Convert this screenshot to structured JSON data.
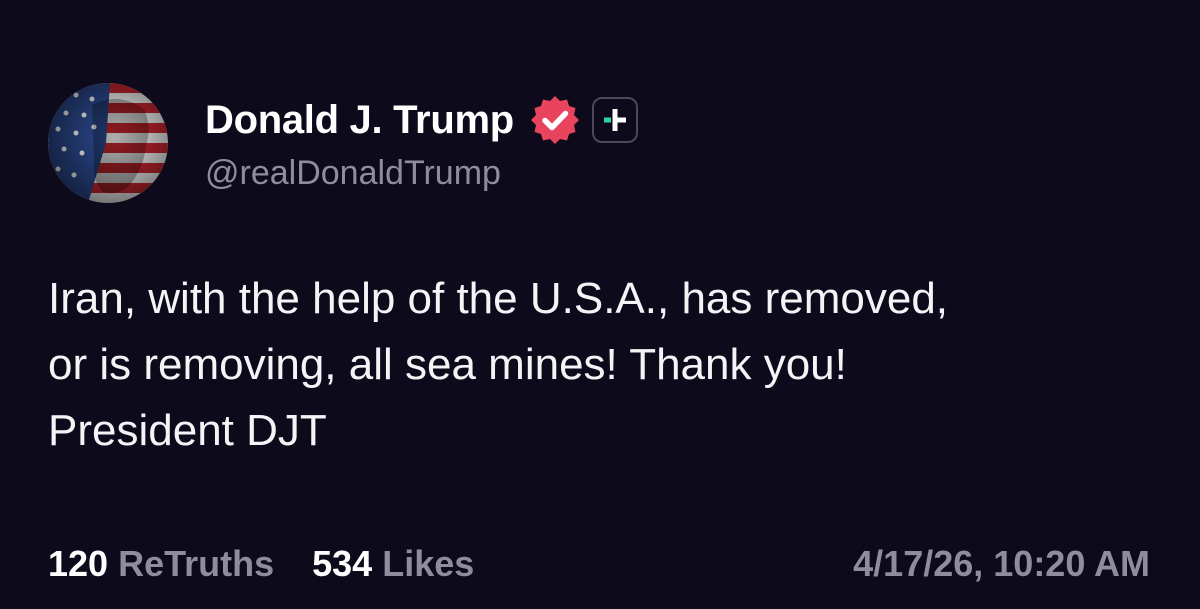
{
  "post": {
    "author": {
      "display_name": "Donald J. Trump",
      "handle": "@realDonaldTrump",
      "verified_icon": "verified-badge-icon",
      "plus_icon": "plus-badge-icon",
      "avatar": "stars-and-stripes-portrait"
    },
    "text": "Iran, with the help of the U.S.A., has removed,\nor is removing, all sea mines! Thank you!\nPresident DJT",
    "stats": {
      "retruths_count": "120",
      "retruths_label": "ReTruths",
      "likes_count": "534",
      "likes_label": "Likes"
    },
    "timestamp": "4/17/26, 10:20 AM"
  },
  "colors": {
    "background": "#0c0a1b",
    "primary_text": "#ffffff",
    "secondary_text": "#8e8d9c",
    "verified_badge": "#e8445e",
    "plus_accent": "#2fd4a6"
  }
}
